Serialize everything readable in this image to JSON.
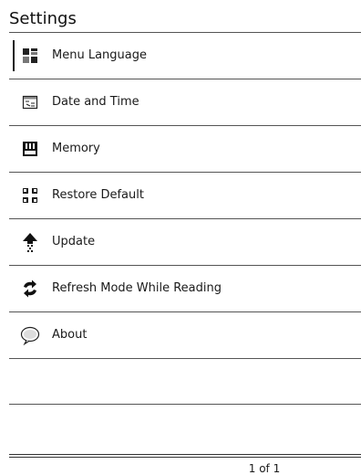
{
  "header": {
    "title": "Settings"
  },
  "menu": {
    "items": [
      {
        "label": "Menu Language",
        "icon": "language-icon",
        "selected": true
      },
      {
        "label": "Date and Time",
        "icon": "calendar-icon",
        "selected": false
      },
      {
        "label": "Memory",
        "icon": "memory-card-icon",
        "selected": false
      },
      {
        "label": "Restore Default",
        "icon": "restore-icon",
        "selected": false
      },
      {
        "label": "Update",
        "icon": "update-arrow-icon",
        "selected": false
      },
      {
        "label": "Refresh Mode While Reading",
        "icon": "refresh-icon",
        "selected": false
      },
      {
        "label": "About",
        "icon": "speech-bubble-icon",
        "selected": false
      }
    ]
  },
  "footer": {
    "pagination": "1 of 1"
  }
}
